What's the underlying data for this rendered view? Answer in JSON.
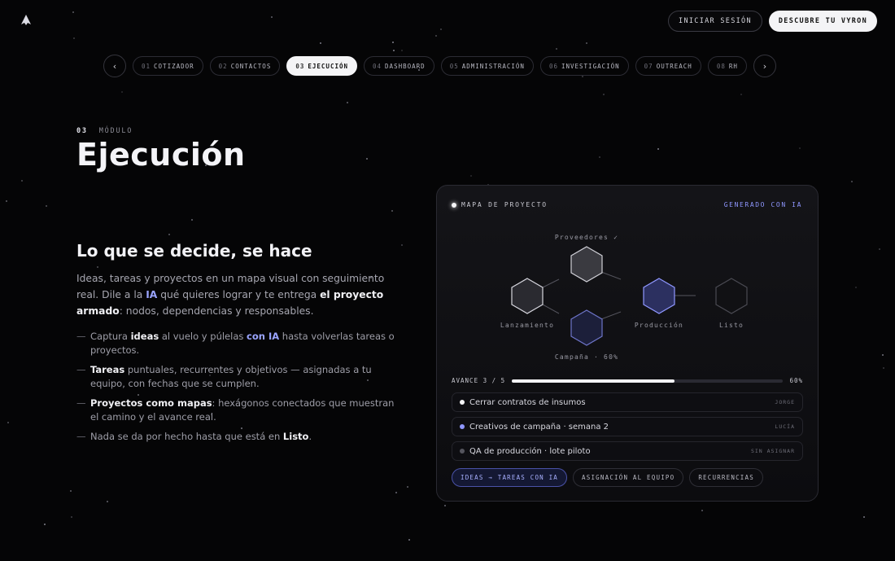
{
  "header": {
    "login_label": "INICIAR SESIÓN",
    "cta_label": "DESCUBRE TU VYRON"
  },
  "tabs": [
    {
      "num": "01",
      "label": "COTIZADOR",
      "active": false
    },
    {
      "num": "02",
      "label": "CONTACTOS",
      "active": false
    },
    {
      "num": "03",
      "label": "EJECUCIÓN",
      "active": true
    },
    {
      "num": "04",
      "label": "DASHBOARD",
      "active": false
    },
    {
      "num": "05",
      "label": "ADMINISTRACIÓN",
      "active": false
    },
    {
      "num": "06",
      "label": "INVESTIGACIÓN",
      "active": false
    },
    {
      "num": "07",
      "label": "OUTREACH",
      "active": false
    },
    {
      "num": "08",
      "label": "RH",
      "active": false
    }
  ],
  "nav": {
    "prev": "‹",
    "next": "›"
  },
  "module": {
    "number": "03",
    "kicker": "MÓDULO",
    "title": "Ejecución",
    "subtitle": "Lo que se decide, se hace",
    "lead": {
      "p1": "Ideas, tareas y proyectos en un mapa visual con seguimiento real. Dile a la ",
      "hi": "IA",
      "p2": " qué quieres lograr y te entrega ",
      "bold": "el proyecto armado",
      "p3": ": nodos, dependencias y responsables."
    },
    "bullets": [
      {
        "a": "Captura ",
        "b": "ideas",
        "c": " al vuelo y púlelas ",
        "d": "con IA",
        "e": " hasta volverlas tareas o proyectos."
      },
      {
        "b": "Tareas",
        "c": " puntuales, recurrentes y objetivos — asignadas a tu equipo, con fechas que se cumplen."
      },
      {
        "b": "Proyectos como mapas",
        "c": ": hexágonos conectados que muestran el camino y el avance real."
      },
      {
        "a": "Nada se da por hecho hasta que está en ",
        "b": "Listo",
        "c": "."
      }
    ]
  },
  "panel": {
    "title": "MAPA DE PROYECTO",
    "badge": "GENERADO CON IA",
    "nodes": {
      "lanzamiento": "Lanzamiento",
      "proveedores": "Proveedores ✓",
      "campana": "Campaña · 60%",
      "produccion": "Producción",
      "listo": "Listo"
    },
    "progress": {
      "label": "AVANCE 3 / 5",
      "percent_label": "60%",
      "value": 0.6
    },
    "tasks": [
      {
        "text": "Cerrar contratos de insumos",
        "owner": "JORGE",
        "dot_color": "#f4f4f6"
      },
      {
        "text": "Creativos de campaña · semana 2",
        "owner": "LUCÍA",
        "dot_color": "#8f97ff"
      },
      {
        "text": "QA de producción · lote piloto",
        "owner": "SIN ASIGNAR",
        "dot_color": "#55555e"
      }
    ],
    "chips": [
      {
        "label": "IDEAS → TAREAS CON IA",
        "active": true
      },
      {
        "label": "ASIGNACIÓN AL EQUIPO",
        "active": false
      },
      {
        "label": "RECURRENCIAS",
        "active": false
      }
    ]
  },
  "colors": {
    "accent": "#8f97ff",
    "background": "#050506"
  }
}
